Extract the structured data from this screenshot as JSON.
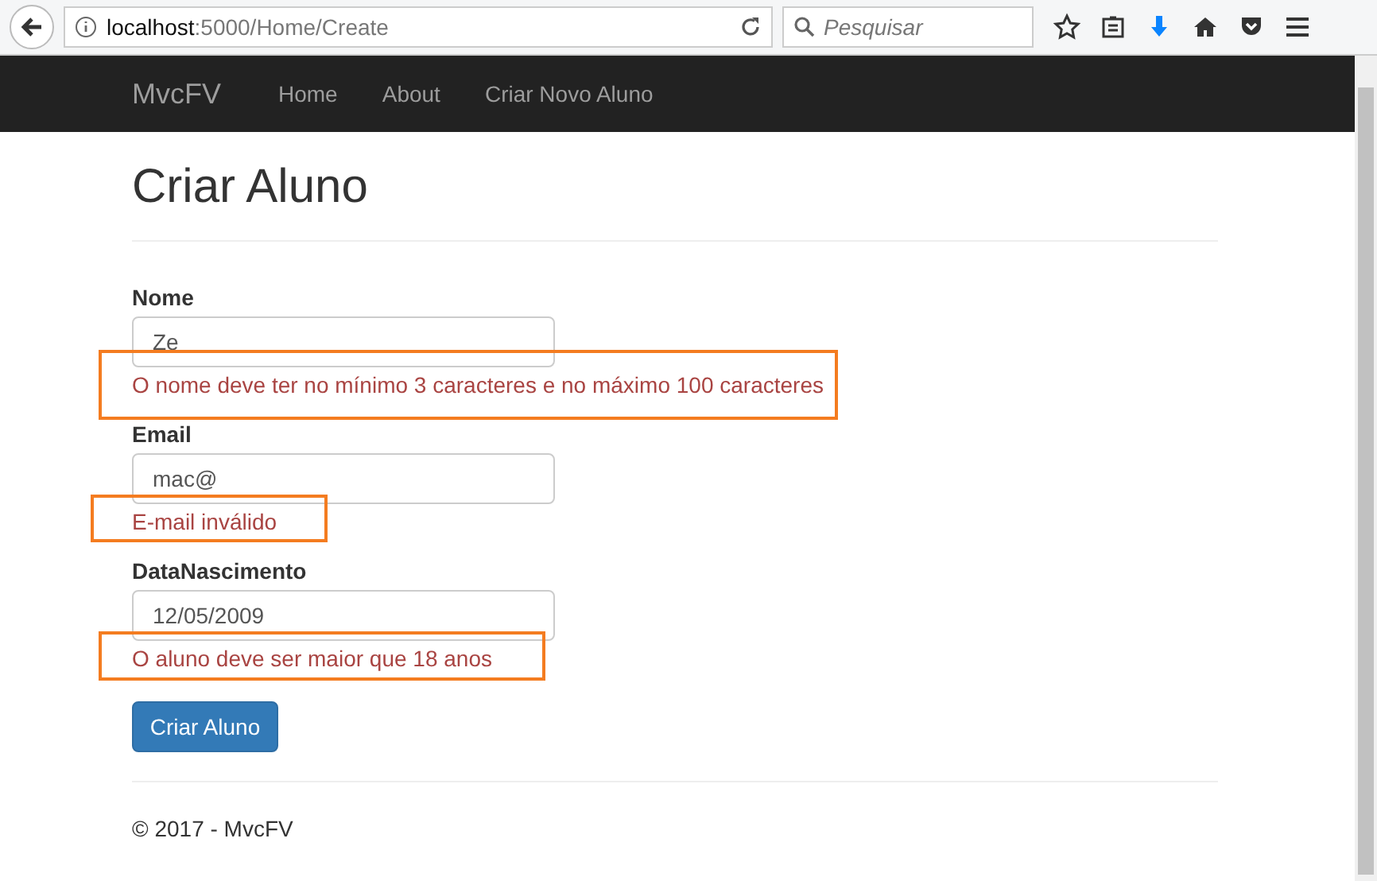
{
  "browser": {
    "url_host": "localhost",
    "url_path": ":5000/Home/Create",
    "search": {
      "placeholder": "Pesquisar"
    }
  },
  "navbar": {
    "brand": "MvcFV",
    "links": [
      {
        "label": "Home"
      },
      {
        "label": "About"
      },
      {
        "label": "Criar Novo Aluno"
      }
    ]
  },
  "page": {
    "title": "Criar Aluno",
    "fields": [
      {
        "label": "Nome",
        "value": "Ze",
        "error": "O nome deve ter no mínimo 3 caracteres e no máximo 100 caracteres",
        "highlighted": true
      },
      {
        "label": "Email",
        "value": "mac@",
        "error": "E-mail inválido",
        "highlighted": true
      },
      {
        "label": "DataNascimento",
        "value": "12/05/2009",
        "error": "O aluno deve ser maior que 18 anos",
        "highlighted": true
      }
    ],
    "submit": "Criar Aluno"
  },
  "footer": "© 2017 - MvcFV"
}
